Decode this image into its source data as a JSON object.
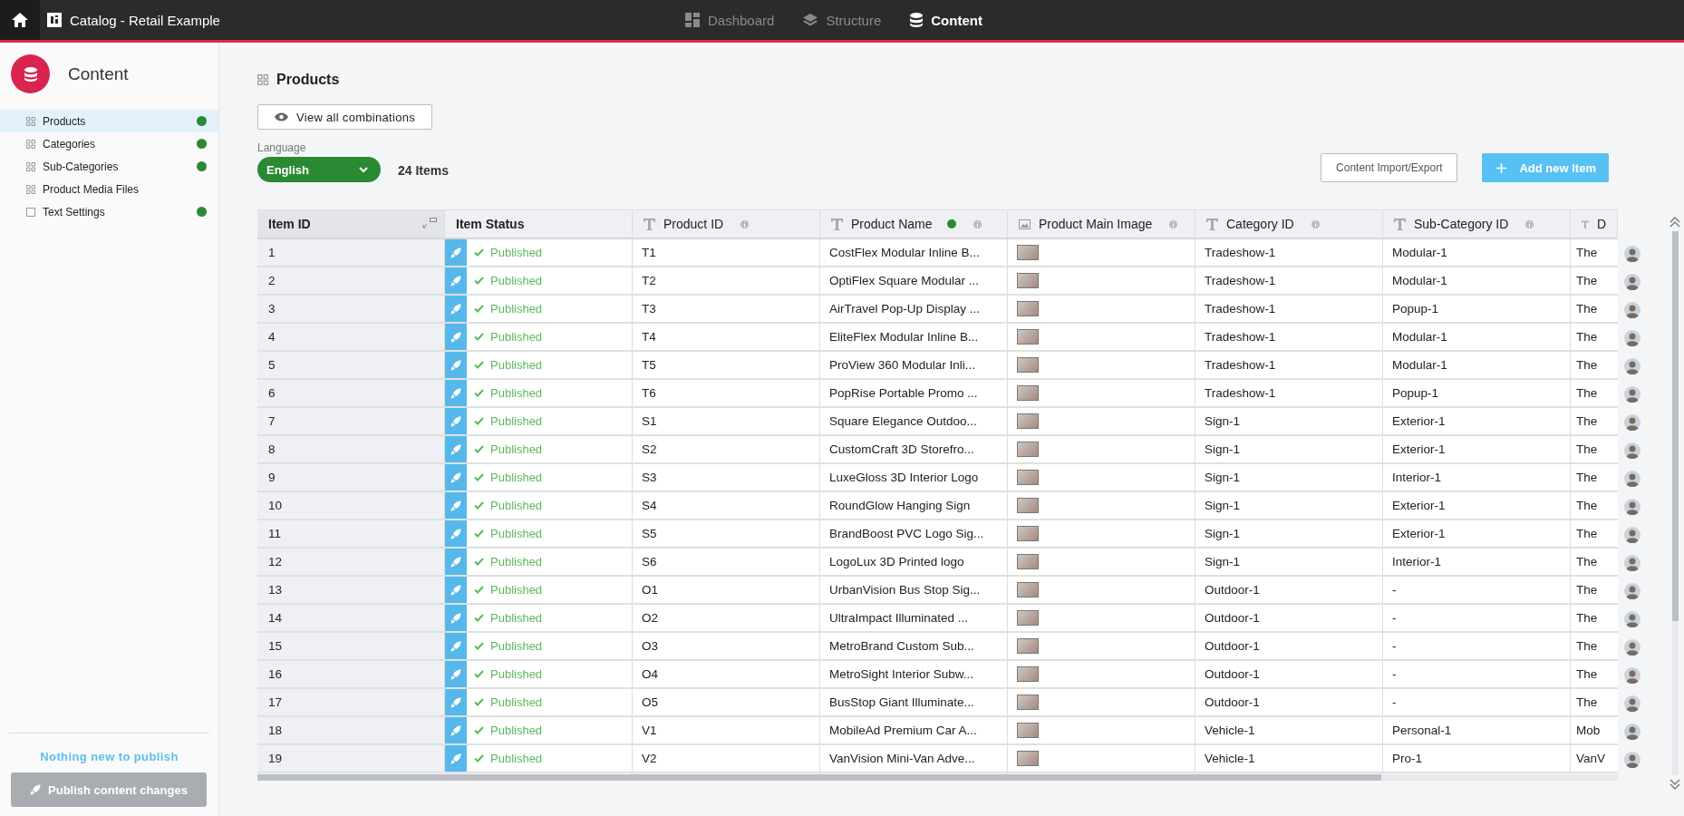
{
  "topbar": {
    "app_title": "Catalog - Retail Example",
    "nav": [
      {
        "label": "Dashboard",
        "selected": false
      },
      {
        "label": "Structure",
        "selected": false
      },
      {
        "label": "Content",
        "selected": true
      }
    ]
  },
  "sidebar": {
    "title": "Content",
    "items": [
      {
        "label": "Products",
        "kind": "grid",
        "selected": true,
        "dot": true
      },
      {
        "label": "Categories",
        "kind": "grid",
        "selected": false,
        "dot": true
      },
      {
        "label": "Sub-Categories",
        "kind": "grid",
        "selected": false,
        "dot": true
      },
      {
        "label": "Product Media Files",
        "kind": "grid",
        "selected": false,
        "dot": false
      },
      {
        "label": "Text Settings",
        "kind": "square",
        "selected": false,
        "dot": true
      }
    ],
    "publish_status": "Nothing new to publish",
    "publish_button": {
      "label": "Publish content changes",
      "disabled": true
    }
  },
  "page": {
    "title": "Products",
    "view_button": "View all combinations",
    "language_label": "Language",
    "language": "English",
    "item_count": "24 Items",
    "import_button": "Content Import/Export",
    "add_button": "Add new Item"
  },
  "table": {
    "columns": [
      {
        "label": "Item ID",
        "kind": "id",
        "info": false,
        "dot": false
      },
      {
        "label": "Item Status",
        "kind": "status",
        "info": false,
        "dot": false
      },
      {
        "label": "Product ID",
        "kind": "text",
        "info": true,
        "dot": false
      },
      {
        "label": "Product Name",
        "kind": "text",
        "info": true,
        "dot": true
      },
      {
        "label": "Product Main Image",
        "kind": "image",
        "info": true,
        "dot": false
      },
      {
        "label": "Category ID",
        "kind": "text",
        "info": true,
        "dot": false
      },
      {
        "label": "Sub-Category ID",
        "kind": "text",
        "info": true,
        "dot": false
      },
      {
        "label": "D",
        "kind": "text",
        "info": false,
        "dot": false
      }
    ],
    "rows": [
      {
        "item_id": "1",
        "status": "Published",
        "product_id": "T1",
        "product_name": "CostFlex Modular Inline B...",
        "category_id": "Tradeshow-1",
        "subcategory_id": "Modular-1",
        "column_8": "The"
      },
      {
        "item_id": "2",
        "status": "Published",
        "product_id": "T2",
        "product_name": "OptiFlex Square Modular ...",
        "category_id": "Tradeshow-1",
        "subcategory_id": "Modular-1",
        "column_8": "The"
      },
      {
        "item_id": "3",
        "status": "Published",
        "product_id": "T3",
        "product_name": "AirTravel Pop-Up Display ...",
        "category_id": "Tradeshow-1",
        "subcategory_id": "Popup-1",
        "column_8": "The"
      },
      {
        "item_id": "4",
        "status": "Published",
        "product_id": "T4",
        "product_name": "EliteFlex Modular Inline B...",
        "category_id": "Tradeshow-1",
        "subcategory_id": "Modular-1",
        "column_8": "The"
      },
      {
        "item_id": "5",
        "status": "Published",
        "product_id": "T5",
        "product_name": "ProView 360 Modular Inli...",
        "category_id": "Tradeshow-1",
        "subcategory_id": "Modular-1",
        "column_8": "The"
      },
      {
        "item_id": "6",
        "status": "Published",
        "product_id": "T6",
        "product_name": "PopRise Portable Promo ...",
        "category_id": "Tradeshow-1",
        "subcategory_id": "Popup-1",
        "column_8": "The"
      },
      {
        "item_id": "7",
        "status": "Published",
        "product_id": "S1",
        "product_name": "Square Elegance Outdoo...",
        "category_id": "Sign-1",
        "subcategory_id": "Exterior-1",
        "column_8": "The"
      },
      {
        "item_id": "8",
        "status": "Published",
        "product_id": "S2",
        "product_name": "CustomCraft 3D Storefro...",
        "category_id": "Sign-1",
        "subcategory_id": "Exterior-1",
        "column_8": "The"
      },
      {
        "item_id": "9",
        "status": "Published",
        "product_id": "S3",
        "product_name": "LuxeGloss 3D Interior Logo",
        "category_id": "Sign-1",
        "subcategory_id": "Interior-1",
        "column_8": "The"
      },
      {
        "item_id": "10",
        "status": "Published",
        "product_id": "S4",
        "product_name": "RoundGlow Hanging Sign",
        "category_id": "Sign-1",
        "subcategory_id": "Exterior-1",
        "column_8": "The"
      },
      {
        "item_id": "11",
        "status": "Published",
        "product_id": "S5",
        "product_name": "BrandBoost PVC Logo Sig...",
        "category_id": "Sign-1",
        "subcategory_id": "Exterior-1",
        "column_8": "The"
      },
      {
        "item_id": "12",
        "status": "Published",
        "product_id": "S6",
        "product_name": "LogoLux 3D Printed logo",
        "category_id": "Sign-1",
        "subcategory_id": "Interior-1",
        "column_8": "The"
      },
      {
        "item_id": "13",
        "status": "Published",
        "product_id": "O1",
        "product_name": "UrbanVision Bus Stop Sig...",
        "category_id": "Outdoor-1",
        "subcategory_id": "-",
        "column_8": "The"
      },
      {
        "item_id": "14",
        "status": "Published",
        "product_id": "O2",
        "product_name": "UltraImpact Illuminated ...",
        "category_id": "Outdoor-1",
        "subcategory_id": "-",
        "column_8": "The"
      },
      {
        "item_id": "15",
        "status": "Published",
        "product_id": "O3",
        "product_name": "MetroBrand Custom Sub...",
        "category_id": "Outdoor-1",
        "subcategory_id": "-",
        "column_8": "The"
      },
      {
        "item_id": "16",
        "status": "Published",
        "product_id": "O4",
        "product_name": "MetroSight Interior Subw...",
        "category_id": "Outdoor-1",
        "subcategory_id": "-",
        "column_8": "The"
      },
      {
        "item_id": "17",
        "status": "Published",
        "product_id": "O5",
        "product_name": "BusStop Giant Illuminate...",
        "category_id": "Outdoor-1",
        "subcategory_id": "-",
        "column_8": "The"
      },
      {
        "item_id": "18",
        "status": "Published",
        "product_id": "V1",
        "product_name": "MobileAd Premium Car A...",
        "category_id": "Vehicle-1",
        "subcategory_id": "Personal-1",
        "column_8": "Mob"
      },
      {
        "item_id": "19",
        "status": "Published",
        "product_id": "V2",
        "product_name": "VanVision Mini-Van Adve...",
        "category_id": "Vehicle-1",
        "subcategory_id": "Pro-1",
        "column_8": "VanV"
      }
    ]
  }
}
